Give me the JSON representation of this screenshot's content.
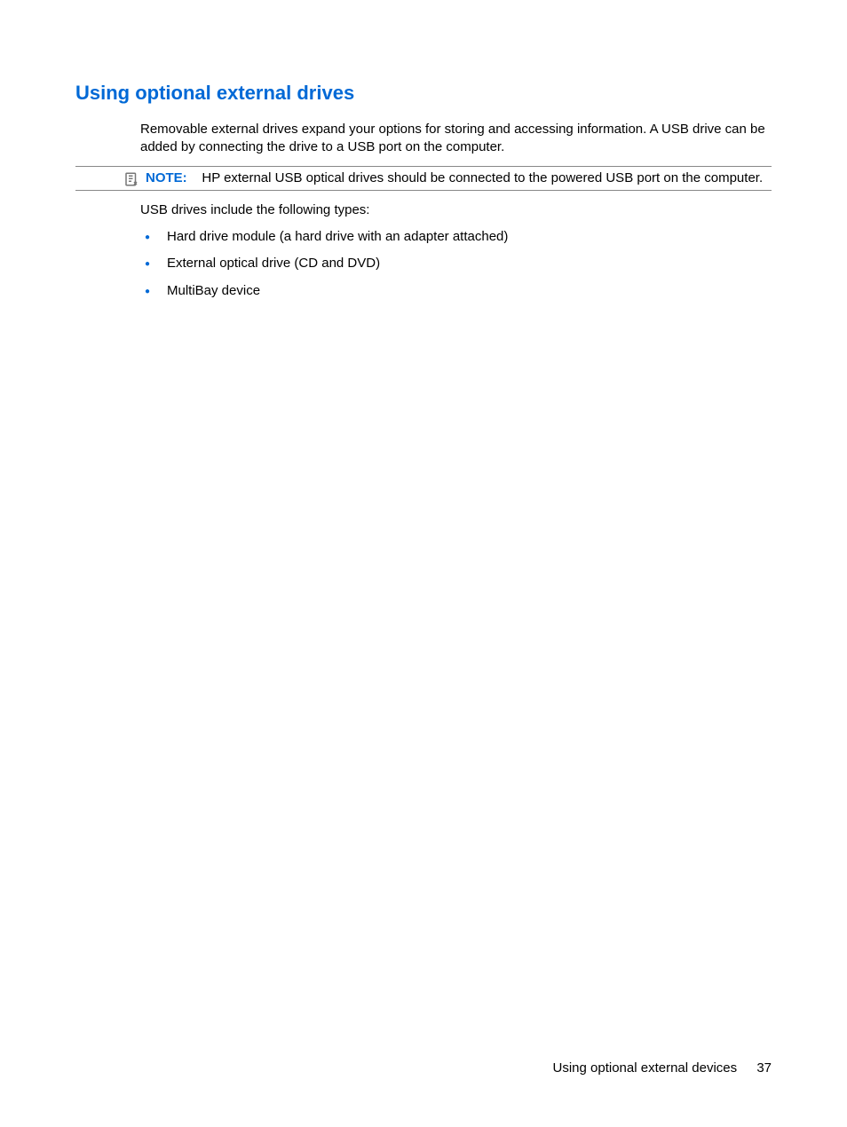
{
  "heading": "Using optional external drives",
  "intro": "Removable external drives expand your options for storing and accessing information. A USB drive can be added by connecting the drive to a USB port on the computer.",
  "note": {
    "label": "NOTE:",
    "text": "HP external USB optical drives should be connected to the powered USB port on the computer."
  },
  "lead_in": "USB drives include the following types:",
  "bullets": [
    "Hard drive module (a hard drive with an adapter attached)",
    "External optical drive (CD and DVD)",
    "MultiBay device"
  ],
  "footer": {
    "section": "Using optional external devices",
    "page": "37"
  }
}
